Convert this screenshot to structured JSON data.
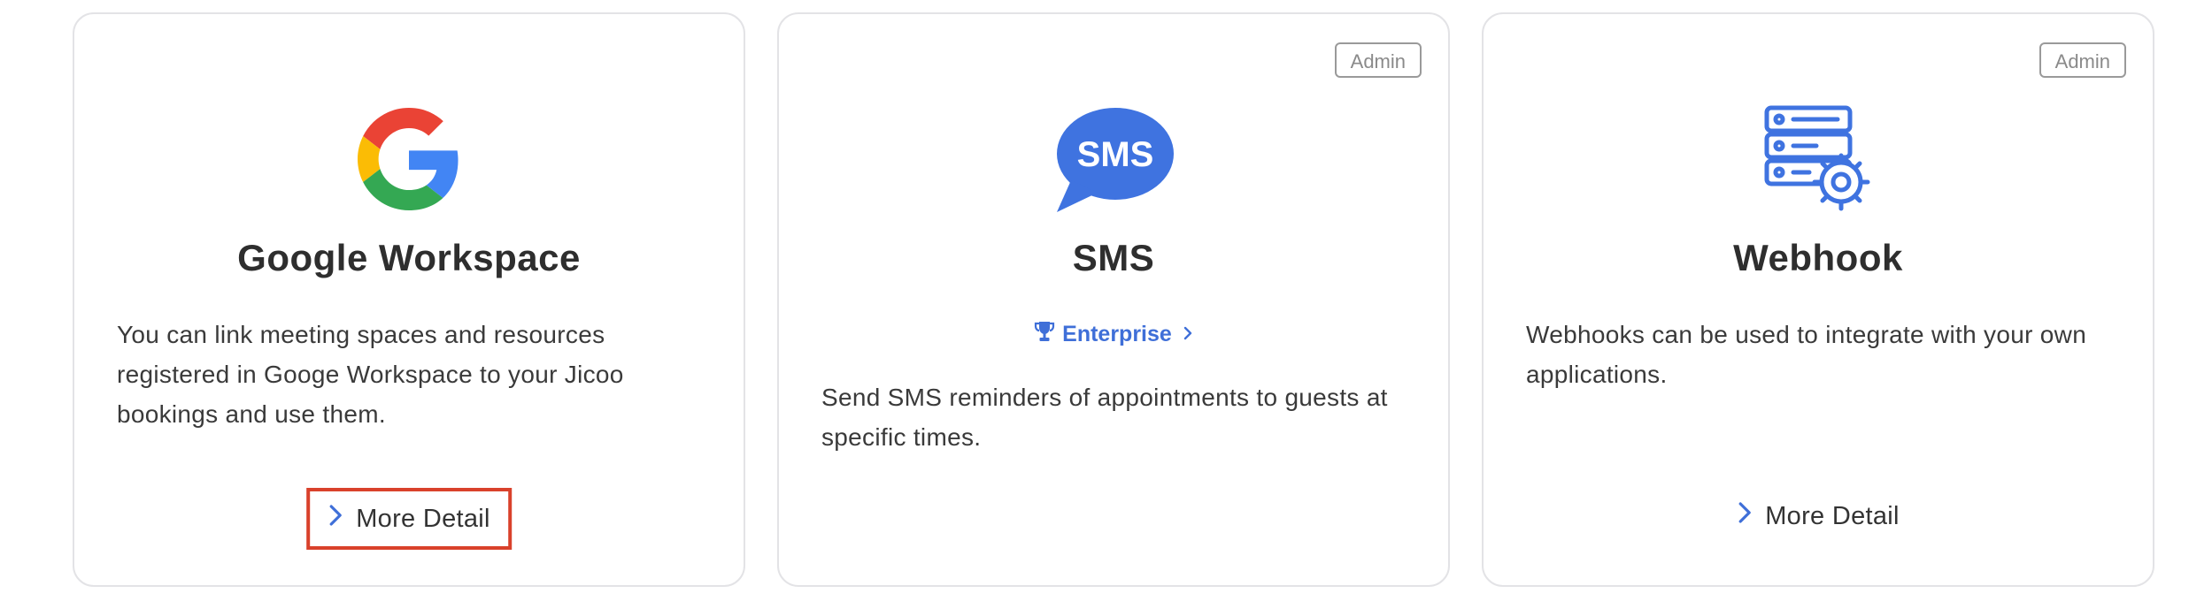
{
  "cards": [
    {
      "title": "Google Workspace",
      "description": "You can link meeting spaces and resources registered in Googe Workspace to your Jicoo bookings and use them.",
      "icon": "google-g-logo-icon",
      "more_detail_label": "More Detail"
    },
    {
      "title": "SMS",
      "badge": "Admin",
      "icon": "sms-chat-bubble-icon",
      "icon_text": "SMS",
      "plan_label": "Enterprise",
      "description": "Send SMS reminders of appointments to guests at specific times."
    },
    {
      "title": "Webhook",
      "badge": "Admin",
      "icon": "server-gear-icon",
      "description": "Webhooks can be used to integrate with your own applications.",
      "more_detail_label": "More Detail"
    }
  ],
  "colors": {
    "accent_blue": "#3f6fd8",
    "highlight_red": "#d9412b",
    "card_border": "#e3e3e6",
    "text_dark": "#2e2e2e"
  }
}
